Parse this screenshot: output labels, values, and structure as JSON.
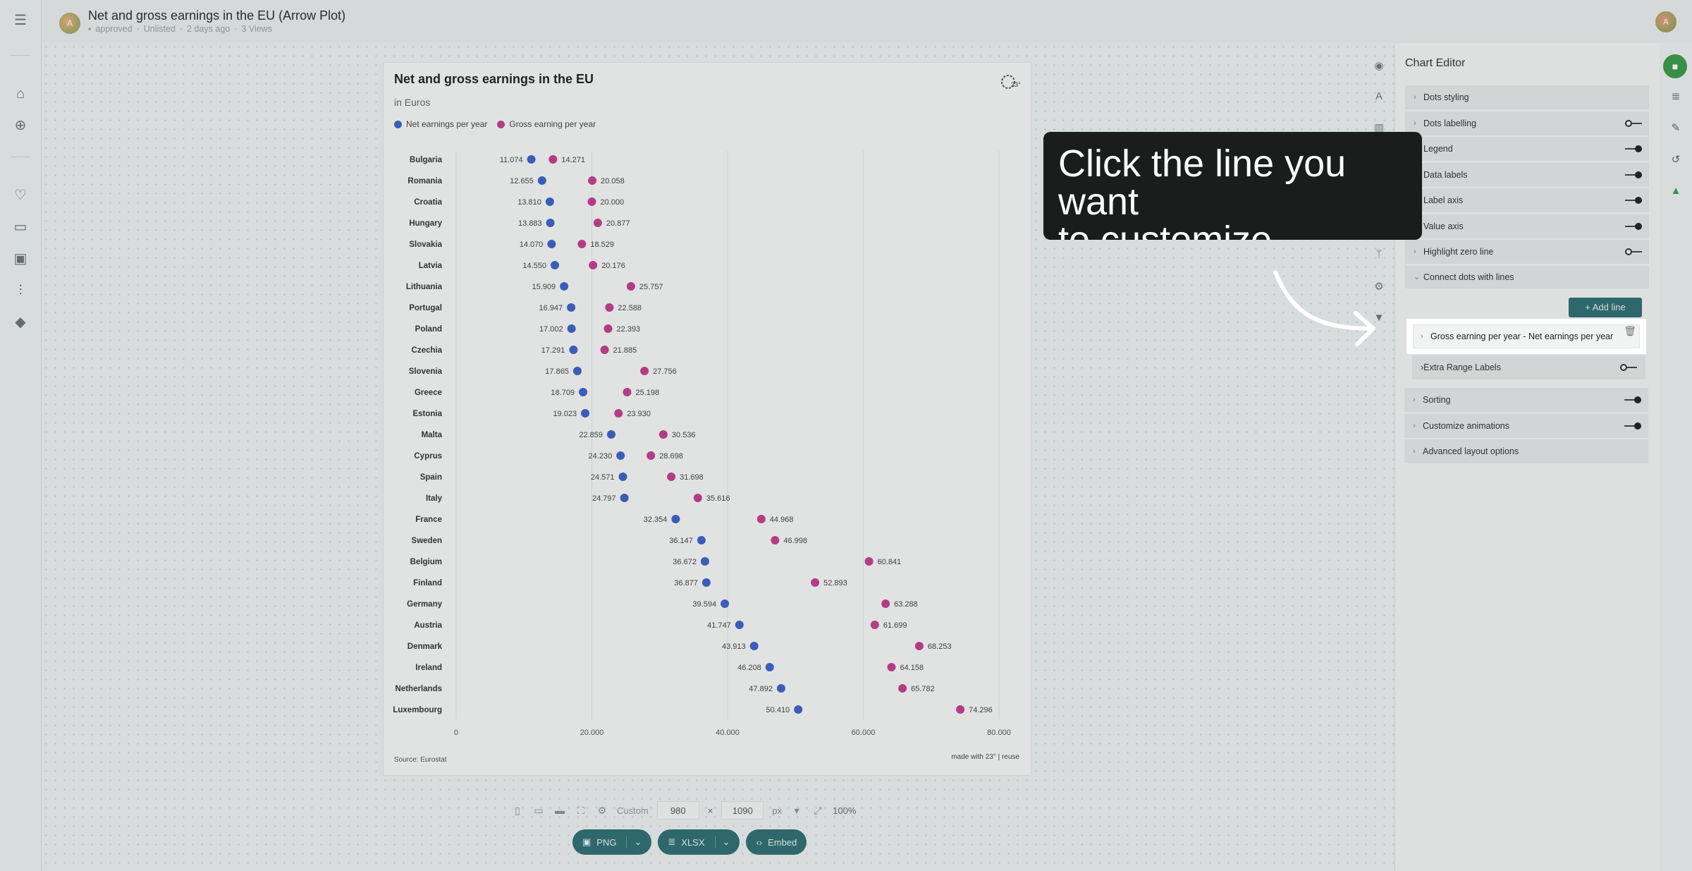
{
  "header": {
    "title": "Net and gross earnings in the EU (Arrow Plot)",
    "meta": [
      "approved",
      "Unlisted",
      "2 days ago",
      "3 Views"
    ],
    "avatar_initial": "A",
    "user_initial": "A"
  },
  "chart": {
    "title": "Net and gross earnings in the EU",
    "subtitle": "in Euros",
    "legend": [
      "Net earnings per year",
      "Gross earning per year"
    ],
    "source": "Source: Eurostat",
    "made_with": "made with 23° | reuse"
  },
  "chart_data": {
    "type": "scatter",
    "subtype": "dumbbell",
    "title": "Net and gross earnings in the EU",
    "subtitle": "in Euros",
    "xlim": [
      0,
      80000
    ],
    "x_ticks": [
      "0",
      "20.000",
      "40.000",
      "60.000",
      "80.000"
    ],
    "x_tick_values": [
      0,
      20000,
      40000,
      60000,
      80000
    ],
    "grid": true,
    "series_colors": {
      "net": "#3e63c8",
      "gross": "#c23f8f"
    },
    "categories": [
      "Bulgaria",
      "Romania",
      "Croatia",
      "Hungary",
      "Slovakia",
      "Latvia",
      "Lithuania",
      "Portugal",
      "Poland",
      "Czechia",
      "Slovenia",
      "Greece",
      "Estonia",
      "Malta",
      "Cyprus",
      "Spain",
      "Italy",
      "France",
      "Sweden",
      "Belgium",
      "Finland",
      "Germany",
      "Austria",
      "Denmark",
      "Ireland",
      "Netherlands",
      "Luxembourg"
    ],
    "series": [
      {
        "name": "Net earnings per year",
        "values": [
          11074,
          12655,
          13810,
          13883,
          14070,
          14550,
          15909,
          16947,
          17002,
          17291,
          17865,
          18709,
          19023,
          22859,
          24230,
          24571,
          24797,
          32354,
          36147,
          36672,
          36877,
          39594,
          41747,
          43913,
          46208,
          47892,
          50410
        ],
        "labels": [
          "11.074",
          "12.655",
          "13.810",
          "13.883",
          "14.070",
          "14.550",
          "15.909",
          "16.947",
          "17.002",
          "17.291",
          "17.865",
          "18.709",
          "19.023",
          "22.859",
          "24.230",
          "24.571",
          "24.797",
          "32.354",
          "36.147",
          "36.672",
          "36.877",
          "39.594",
          "41.747",
          "43.913",
          "46.208",
          "47.892",
          "50.410"
        ]
      },
      {
        "name": "Gross earning per year",
        "values": [
          14271,
          20058,
          20000,
          20877,
          18529,
          20176,
          25757,
          22588,
          22393,
          21885,
          27756,
          25198,
          23930,
          30536,
          28698,
          31698,
          35616,
          44968,
          46998,
          60841,
          52893,
          63288,
          61699,
          68253,
          64158,
          65782,
          74296
        ],
        "labels": [
          "14.271",
          "20.058",
          "20.000",
          "20.877",
          "18.529",
          "20.176",
          "25.757",
          "22.588",
          "22.393",
          "21.885",
          "27.756",
          "25.198",
          "23.930",
          "30.536",
          "28.698",
          "31.698",
          "35.616",
          "44.968",
          "46.998",
          "60.841",
          "52.893",
          "63.288",
          "61.699",
          "68.253",
          "64.158",
          "65.782",
          "74.296"
        ]
      }
    ]
  },
  "sizebar": {
    "preset": "Custom",
    "width": "980",
    "times": "×",
    "height": "1090",
    "unit": "px",
    "zoom": "100%"
  },
  "export": {
    "png": "PNG",
    "xlsx": "XLSX",
    "embed": "Embed"
  },
  "editor": {
    "title": "Chart Editor",
    "sections": [
      {
        "label": "Dots styling",
        "toggle": null
      },
      {
        "label": "Dots labelling",
        "toggle": "off"
      },
      {
        "label": "Legend",
        "toggle": "on"
      },
      {
        "label": "Data labels",
        "toggle": "on"
      },
      {
        "label": "Label axis",
        "toggle": "on"
      },
      {
        "label": "Value axis",
        "toggle": "on"
      },
      {
        "label": "Highlight zero line",
        "toggle": "off"
      },
      {
        "label": "Connect dots with lines",
        "toggle": null
      }
    ],
    "add_line": "+ Add line",
    "line_item": "Gross earning per year - Net earnings per year",
    "extra_range": "Extra Range Labels",
    "sections_after": [
      {
        "label": "Sorting",
        "toggle": "on"
      },
      {
        "label": "Customize animations",
        "toggle": "on"
      },
      {
        "label": "Advanced layout options",
        "toggle": null
      }
    ]
  },
  "tooltip": {
    "text": "Click the line you want\nto customize"
  },
  "icons": {
    "menu": "menu-icon",
    "home": "home-icon",
    "add": "add-circle-icon",
    "favorites": "heart-icon",
    "folder": "folder-icon",
    "images": "image-icon",
    "settings": "sliders-icon",
    "learn": "graduation-cap-icon"
  }
}
